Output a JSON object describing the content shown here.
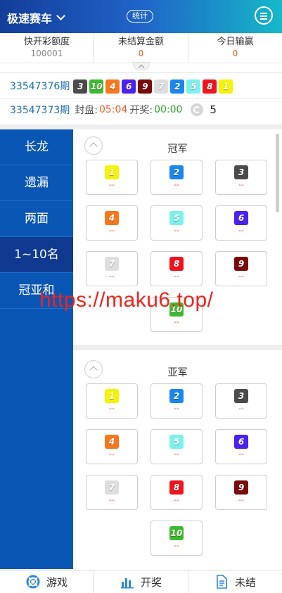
{
  "header": {
    "title": "极速赛车",
    "stats_label": "统计"
  },
  "summary": [
    {
      "label": "快开彩额度",
      "value": "100001"
    },
    {
      "label": "未结算金额",
      "value": "0"
    },
    {
      "label": "今日输赢",
      "value": "0"
    }
  ],
  "latest_draw": {
    "period": "33547376期",
    "numbers": [
      "3",
      "10",
      "4",
      "6",
      "9",
      "7",
      "2",
      "5",
      "8",
      "1"
    ]
  },
  "next_draw": {
    "period": "33547373期",
    "close_label": "封盘:",
    "close_time": "05:04",
    "open_label": "开奖:",
    "open_time": "00:00",
    "count": "5"
  },
  "sidebar": {
    "items": [
      {
        "label": "长龙"
      },
      {
        "label": "遗漏"
      },
      {
        "label": "两面"
      },
      {
        "label": "1~10名"
      },
      {
        "label": "冠亚和"
      }
    ]
  },
  "sections": [
    {
      "title": "冠军",
      "balls": [
        {
          "num": "1",
          "odds": "--"
        },
        {
          "num": "2",
          "odds": "--"
        },
        {
          "num": "3",
          "odds": "--"
        },
        {
          "num": "4",
          "odds": "--"
        },
        {
          "num": "5",
          "odds": "--"
        },
        {
          "num": "6",
          "odds": "--"
        },
        {
          "num": "7",
          "odds": "--"
        },
        {
          "num": "8",
          "odds": "--"
        },
        {
          "num": "9",
          "odds": "--"
        },
        {
          "num": "10",
          "odds": "--"
        }
      ]
    },
    {
      "title": "亚军",
      "balls": [
        {
          "num": "1",
          "odds": "--"
        },
        {
          "num": "2",
          "odds": "--"
        },
        {
          "num": "3",
          "odds": "--"
        },
        {
          "num": "4",
          "odds": "--"
        },
        {
          "num": "5",
          "odds": "--"
        },
        {
          "num": "6",
          "odds": "--"
        },
        {
          "num": "7",
          "odds": "--"
        },
        {
          "num": "8",
          "odds": "--"
        },
        {
          "num": "9",
          "odds": "--"
        },
        {
          "num": "10",
          "odds": "--"
        }
      ]
    }
  ],
  "watermark": "https://maku6.top/",
  "footer": {
    "items": [
      {
        "label": "游戏",
        "icon": "lifebuoy-icon"
      },
      {
        "label": "开奖",
        "icon": "bar-chart-icon"
      },
      {
        "label": "未结",
        "icon": "document-icon"
      }
    ]
  },
  "colors": {
    "header_start": "#143d9a",
    "header_end": "#16b8c9",
    "sidebar": "#0a56b4",
    "sidebar_active": "#0f3a8f",
    "accent_red": "#f05a24"
  }
}
